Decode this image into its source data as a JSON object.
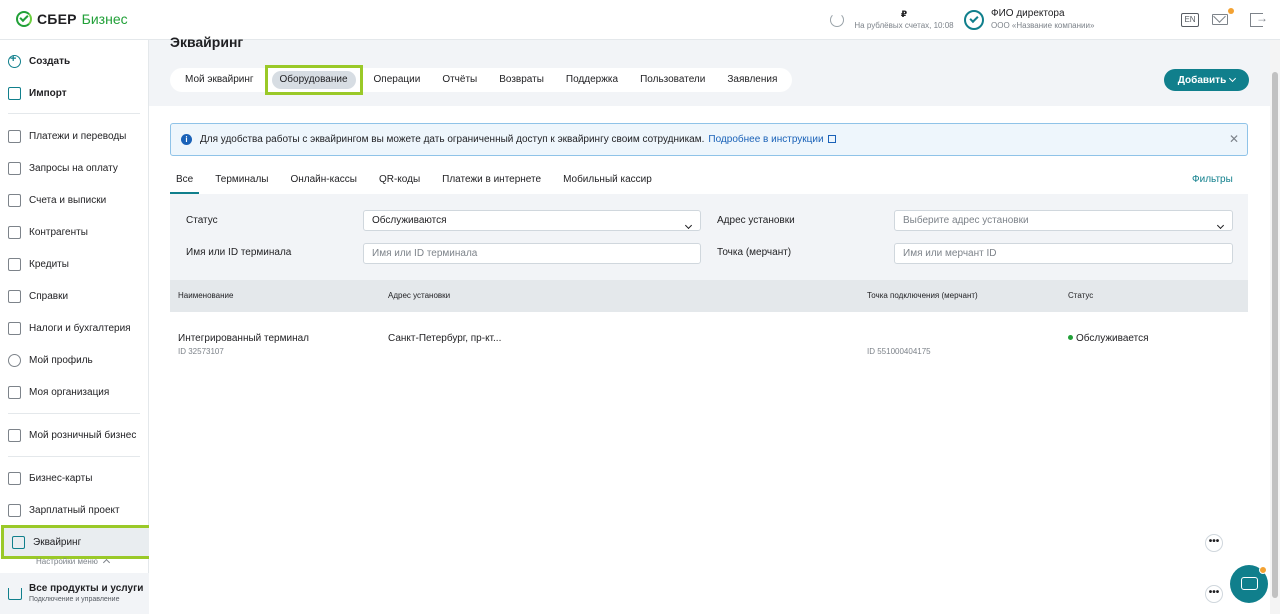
{
  "header": {
    "brand": "СБЕР",
    "brand_sub": "Бизнес",
    "balance_value": "₽",
    "balance_caption": "На рублёвых счетах, 10:08",
    "director": "ФИО директора",
    "company": "ООО «Название компании»",
    "lang": "EN"
  },
  "sidebar": {
    "create": "Создать",
    "import": "Импорт",
    "items": [
      "Платежи и переводы",
      "Запросы на оплату",
      "Счета и выписки",
      "Контрагенты",
      "Кредиты",
      "Справки",
      "Налоги и бухгалтерия",
      "Мой профиль",
      "Моя организация"
    ],
    "retail": "Мой розничный бизнес",
    "cards": "Бизнес-карты",
    "salary": "Зарплатный проект",
    "acquiring": "Эквайринг",
    "menu_settings": "Настройки меню",
    "all_products": "Все продукты и услуги",
    "all_products_sub": "Подключение и управление"
  },
  "main": {
    "title": "Эквайринг",
    "tabs": [
      "Мой эквайринг",
      "Оборудование",
      "Операции",
      "Отчёты",
      "Возвраты",
      "Поддержка",
      "Пользователи",
      "Заявления"
    ],
    "add_button": "Добавить",
    "info_text": "Для удобства работы с эквайрингом вы можете дать ограниченный доступ к эквайрингу своим сотрудникам.",
    "info_link": "Подробнее в инструкции",
    "subtabs": [
      "Все",
      "Терминалы",
      "Онлайн-кассы",
      "QR-коды",
      "Платежи в интернете",
      "Мобильный кассир"
    ],
    "filters_link": "Фильтры",
    "filter": {
      "status_label": "Статус",
      "status_value": "Обслуживаются",
      "address_label": "Адрес установки",
      "address_placeholder": "Выберите адрес установки",
      "terminal_label": "Имя или ID терминала",
      "terminal_placeholder": "Имя или ID терминала",
      "merchant_label": "Точка (мерчант)",
      "merchant_placeholder": "Имя или мерчант ID"
    },
    "table": {
      "headers": [
        "Наименование",
        "Адрес установки",
        "Точка подключения (мерчант)",
        "Статус"
      ],
      "rows": [
        {
          "name": "Интегрированный терминал",
          "id": "ID 32573107",
          "address": "Санкт-Петербург, пр-кт...",
          "merchant_id": "ID 551000404175",
          "status": "Обслуживается"
        }
      ]
    }
  },
  "colors": {
    "accent": "#107f8c",
    "brand_green": "#21a038",
    "highlight": "#9ac928",
    "link": "#1a62b8",
    "notification": "#f3a232"
  }
}
